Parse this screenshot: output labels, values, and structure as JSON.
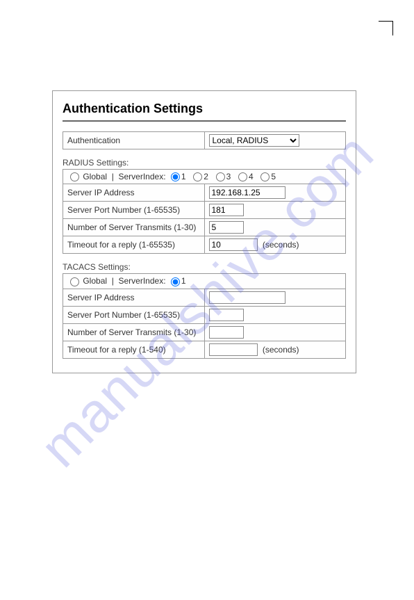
{
  "page_title": "Authentication Settings",
  "auth_row": {
    "label": "Authentication",
    "selected": "Local, RADIUS"
  },
  "radius": {
    "section_label": "RADIUS Settings:",
    "index_row": {
      "global_label": "Global",
      "separator": "|",
      "serverindex_label": "ServerIndex:",
      "options": [
        "1",
        "2",
        "3",
        "4",
        "5"
      ],
      "selected": "1"
    },
    "rows": {
      "ip_label": "Server IP Address",
      "ip_value": "192.168.1.25",
      "port_label": "Server Port Number (1-65535)",
      "port_value": "181",
      "transmits_label": "Number of Server Transmits (1-30)",
      "transmits_value": "5",
      "timeout_label": "Timeout for a reply (1-65535)",
      "timeout_value": "10",
      "timeout_units": "(seconds)"
    }
  },
  "tacacs": {
    "section_label": "TACACS Settings:",
    "index_row": {
      "global_label": "Global",
      "separator": "|",
      "serverindex_label": "ServerIndex:",
      "options": [
        "1"
      ],
      "selected": "1"
    },
    "rows": {
      "ip_label": "Server IP Address",
      "ip_value": "",
      "port_label": "Server Port Number (1-65535)",
      "port_value": "",
      "transmits_label": "Number of Server Transmits (1-30)",
      "transmits_value": "",
      "timeout_label": "Timeout for a reply (1-540)",
      "timeout_value": "",
      "timeout_units": "(seconds)"
    }
  }
}
